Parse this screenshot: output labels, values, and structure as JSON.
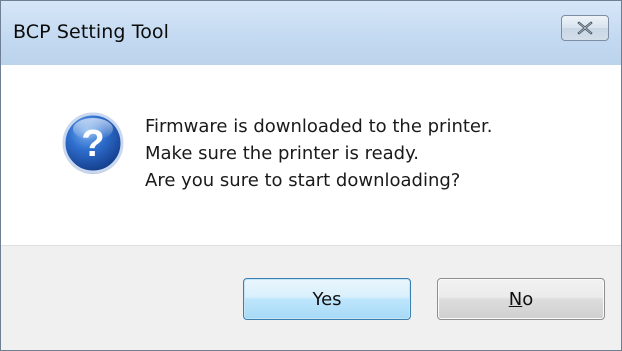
{
  "window": {
    "title": "BCP Setting Tool",
    "close_icon": "close-icon"
  },
  "message": {
    "icon": "question-icon",
    "lines": [
      "Firmware is downloaded to the printer.",
      "Make sure the printer is ready.",
      "Are you sure to start downloading?"
    ]
  },
  "buttons": {
    "yes_label": "Yes",
    "no_mnemonic": "N",
    "no_rest": "o"
  },
  "colors": {
    "titlebar": "#c3d9f1",
    "footer": "#f0f0f0",
    "default_button_border": "#3c7fb1"
  }
}
